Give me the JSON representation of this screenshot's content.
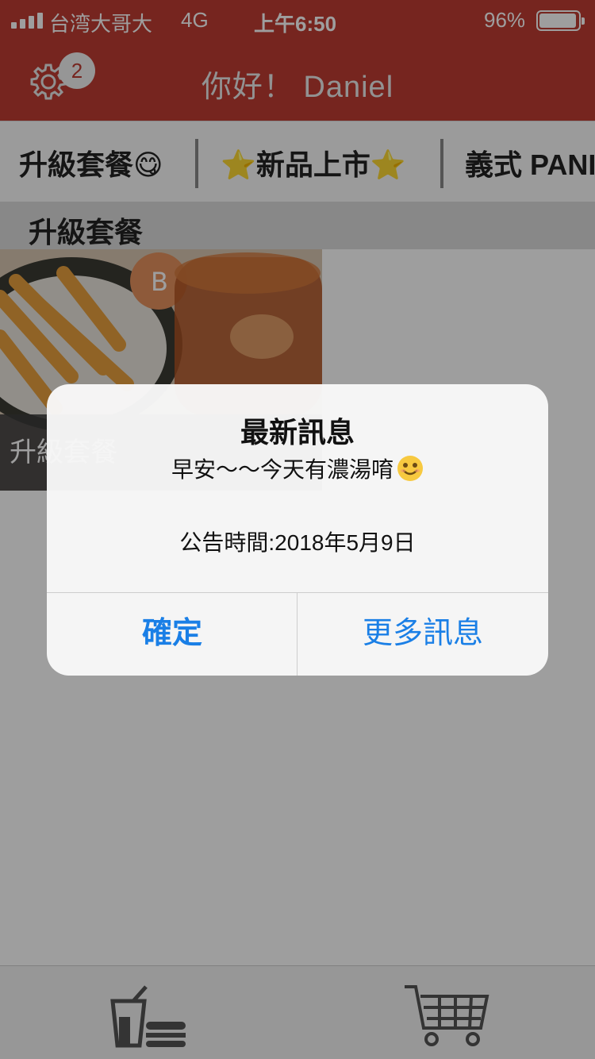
{
  "status_bar": {
    "carrier": "台湾大哥大",
    "network": "4G",
    "time": "上午6:50",
    "battery_percent": "96%",
    "battery_level": 0.96
  },
  "header": {
    "settings_icon": "gear-icon",
    "notification_count": "2",
    "greeting": "你好！ Daniel",
    "color": "#bf3c33"
  },
  "category_tabs": [
    {
      "label": "升級套餐",
      "emoji": "😋"
    },
    {
      "label": "新品上市",
      "emoji": "⭐"
    },
    {
      "label": "義式 PANI"
    }
  ],
  "section": {
    "title": "升級套餐"
  },
  "products": [
    {
      "caption": "升級套餐"
    }
  ],
  "alert": {
    "title": "最新訊息",
    "message": "早安～～今天有濃湯唷",
    "date": "公告時間:2018年5月9日",
    "confirm_label": "確定",
    "more_label": "更多訊息",
    "button_color": "#1a7fe6"
  },
  "tab_bar": {
    "items": [
      {
        "icon": "drink-burger-icon"
      },
      {
        "icon": "shopping-cart-icon"
      }
    ]
  }
}
